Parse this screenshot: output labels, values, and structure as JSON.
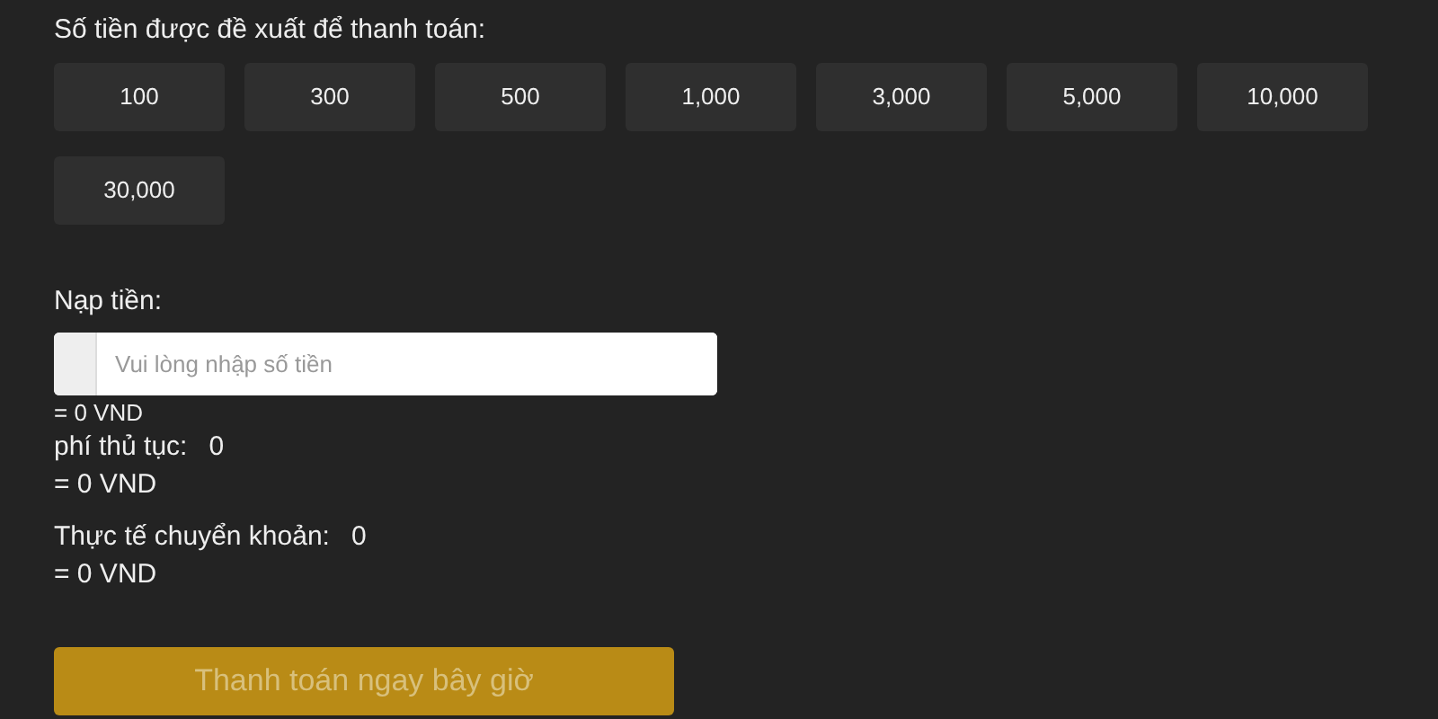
{
  "suggested_label": "Số tiền được đề xuất để thanh toán:",
  "amounts": [
    "100",
    "300",
    "500",
    "1,000",
    "3,000",
    "5,000",
    "10,000",
    "30,000"
  ],
  "deposit": {
    "label": "Nạp tiền:",
    "placeholder": "Vui lòng nhập số tiền",
    "converted": "= 0 VND"
  },
  "fee": {
    "label": "phí thủ tục:",
    "value": "0",
    "converted": "= 0 VND"
  },
  "actual": {
    "label": "Thực tế chuyển khoản:",
    "value": "0",
    "converted": "= 0 VND"
  },
  "submit": {
    "label": "Thanh toán ngay bây giờ",
    "disabled": true
  }
}
